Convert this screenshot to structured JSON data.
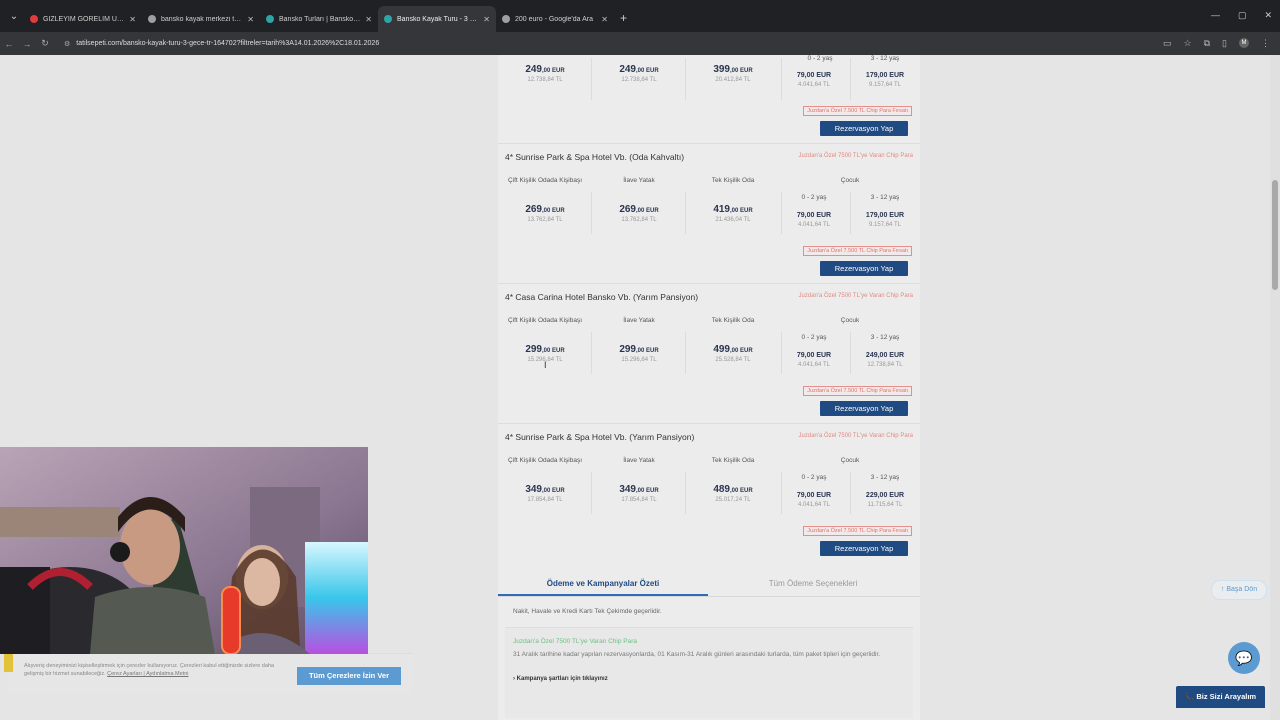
{
  "browser": {
    "tabs": [
      {
        "title": "GİZLEYİM GÖRELİM ULUDAĞ | C",
        "favicon_color": "#e03a3a"
      },
      {
        "title": "bansko kayak merkezi turu - G",
        "favicon_color": "#9aa0a6"
      },
      {
        "title": "Bansko Turları | Bansko Turu Fi",
        "favicon_color": "#2fa4a4"
      },
      {
        "title": "Bansko Kayak Turu - 3 Gece",
        "favicon_color": "#2fa4a4",
        "active": true
      },
      {
        "title": "200 euro - Google'da Ara",
        "favicon_color": "#9aa0a6"
      }
    ],
    "url": "tatilsepeti.com/bansko-kayak-turu-3-gece-tr-164702?filtreler=tarih%3A14.01.2026%2C18.01.2026",
    "profile_initial": "M"
  },
  "columns": {
    "double": "Çift Kişilik Odada Kişibaşı",
    "extra_bed": "İlave Yatak",
    "single": "Tek Kişilik Oda",
    "child": "Çocuk",
    "age_0_2": "0 - 2 yaş",
    "age_3_12": "3 - 12 yaş"
  },
  "reserve_label": "Rezervasyon Yap",
  "top_partial": {
    "prices": [
      {
        "eur": "249",
        "dec": ",00 EUR",
        "tl": "12.738,84 TL"
      },
      {
        "eur": "249",
        "dec": ",00 EUR",
        "tl": "12.738,84 TL"
      },
      {
        "eur": "399",
        "dec": ",00 EUR",
        "tl": "20.412,84 TL"
      }
    ],
    "child_prices": [
      {
        "eur": "79,00 EUR",
        "tl": "4.041,64 TL"
      },
      {
        "eur": "179,00 EUR",
        "tl": "9.157,64 TL"
      }
    ],
    "note": "Juzdan'a Özel 7.500 TL Chip Para Fırsatı"
  },
  "hotels": [
    {
      "name": "4* Sunrise Park & Spa Hotel Vb. (Oda Kahvaltı)",
      "promo": "Juzdan'a Özel 7500 TL'ye Varan Chip Para",
      "prices": [
        {
          "eur": "269",
          "dec": ",00 EUR",
          "tl": "13.762,84 TL"
        },
        {
          "eur": "269",
          "dec": ",00 EUR",
          "tl": "13.762,84 TL"
        },
        {
          "eur": "419",
          "dec": ",00 EUR",
          "tl": "21.436,04 TL"
        }
      ],
      "child_prices": [
        {
          "eur": "79,00 EUR",
          "tl": "4.041,64 TL"
        },
        {
          "eur": "179,00 EUR",
          "tl": "9.157,64 TL"
        }
      ],
      "note": "Juzdan'a Özel 7.500 TL Chip Para Fırsatı"
    },
    {
      "name": "4* Casa Carina Hotel Bansko Vb. (Yarım Pansiyon)",
      "promo": "Juzdan'a Özel 7500 TL'ye Varan Chip Para",
      "prices": [
        {
          "eur": "299",
          "dec": ",00 EUR",
          "tl": "15.296,84 TL"
        },
        {
          "eur": "299",
          "dec": ",00 EUR",
          "tl": "15.296,84 TL"
        },
        {
          "eur": "499",
          "dec": ",00 EUR",
          "tl": "25.528,84 TL"
        }
      ],
      "child_prices": [
        {
          "eur": "79,00 EUR",
          "tl": "4.041,64 TL"
        },
        {
          "eur": "249,00 EUR",
          "tl": "12.738,84 TL"
        }
      ],
      "note": "Juzdan'a Özel 7.500 TL Chip Para Fırsatı"
    },
    {
      "name": "4* Sunrise Park & Spa Hotel Vb. (Yarım Pansiyon)",
      "promo": "Juzdan'a Özel 7500 TL'ye Varan Chip Para",
      "prices": [
        {
          "eur": "349",
          "dec": ",00 EUR",
          "tl": "17.854,84 TL"
        },
        {
          "eur": "349",
          "dec": ",00 EUR",
          "tl": "17.854,84 TL"
        },
        {
          "eur": "489",
          "dec": ",00 EUR",
          "tl": "25.017,24 TL"
        }
      ],
      "child_prices": [
        {
          "eur": "79,00 EUR",
          "tl": "4.041,64 TL"
        },
        {
          "eur": "229,00 EUR",
          "tl": "11.715,64 TL"
        }
      ],
      "note": "Juzdan'a Özel 7.500 TL Chip Para Fırsatı"
    }
  ],
  "payment": {
    "tab_active": "Ödeme ve Kampanyalar Özeti",
    "tab_inactive": "Tüm Ödeme Seçenekleri",
    "info": "Nakit, Havale ve Kredi Kartı Tek Çekimde geçerlidir.",
    "campaign_title": "Juzdan'a Özel 7500 TL'ye Varan Chip Para",
    "campaign_desc": "31 Aralık tarihine kadar yapılan rezervasyonlarda, 01 Kasım-31 Aralık günleri arasındaki turlarda, tüm paket tipleri için geçerlidir.",
    "campaign_link": "› Kampanya şartları için tıklayınız"
  },
  "floating": {
    "back_top": "Başa Dön",
    "call": "Biz Sizi Arayalım"
  },
  "cookie": {
    "text": "Alışveriş deneyiminizi kişiselleştirmek için çerezler kullanıyoruz. Çerezleri kabul ettiğinizde sizlere daha gelişmiş bir hizmet sunabileceğiz.",
    "links": "Çerez Ayarları | Aydınlatma Metni",
    "accept": "Tüm Çerezlere İzin Ver"
  }
}
